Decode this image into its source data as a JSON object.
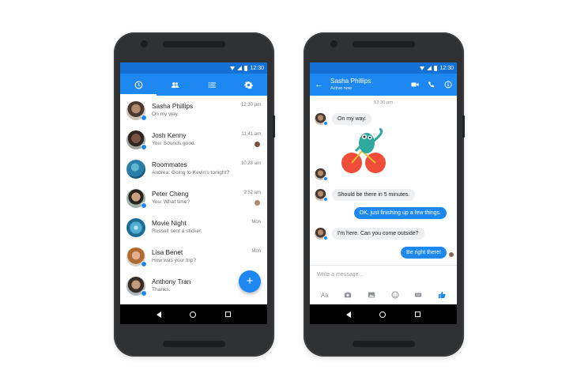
{
  "status_bar": {
    "time": "12:30"
  },
  "colors": {
    "brand_blue": "#1e88f2",
    "status_blue": "#1570d6",
    "bubble_gray": "#eef0f2"
  },
  "left_phone": {
    "tabs": [
      {
        "icon": "clock-icon"
      },
      {
        "icon": "people-icon"
      },
      {
        "icon": "list-icon"
      },
      {
        "icon": "gear-icon"
      }
    ],
    "conversations": [
      {
        "name": "Sasha Phillips",
        "snippet": "On my way.",
        "time": "12:30 pm"
      },
      {
        "name": "Josh Kenny",
        "snippet": "You: Sounds good.",
        "time": "11:41 am"
      },
      {
        "name": "Roommates",
        "snippet": "Andrea: Going to Kevin's tonight?",
        "time": "10:28 am"
      },
      {
        "name": "Peter Cheng",
        "snippet": "You: What time?",
        "time": "9:52 am"
      },
      {
        "name": "Movie Night",
        "snippet": "Russell sent a sticker.",
        "time": "Mon"
      },
      {
        "name": "Lisa Benet",
        "snippet": "How was your trip?",
        "time": "Mon"
      },
      {
        "name": "Anthony Tran",
        "snippet": "Thanks.",
        "time": ""
      }
    ],
    "fab_label": "+"
  },
  "right_phone": {
    "contact_name": "Sasha Phillips",
    "contact_status": "Active now",
    "timestamp": "12:30 pm",
    "messages": [
      {
        "text": "On my way.",
        "from": "them"
      },
      {
        "text": "Should be there in 5 minutes.",
        "from": "them"
      },
      {
        "text": "OK, just finishing up a few things.",
        "from": "me"
      },
      {
        "text": "I'm here. Can you come outside?",
        "from": "them"
      },
      {
        "text": "Be right there!",
        "from": "me"
      }
    ],
    "composer_placeholder": "Write a message...",
    "aa_label": "Aa"
  }
}
